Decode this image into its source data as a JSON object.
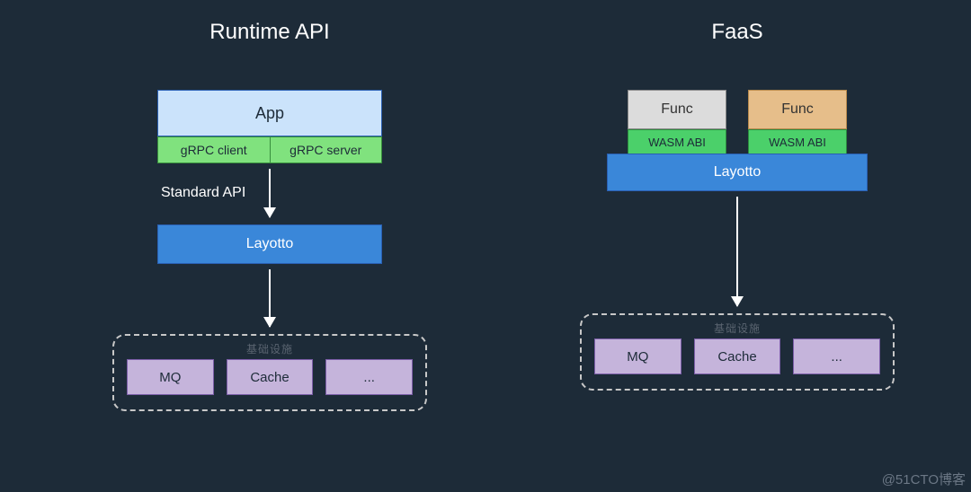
{
  "left": {
    "title": "Runtime API",
    "app_label": "App",
    "grpc_client": "gRPC client",
    "grpc_server": "gRPC server",
    "api_label": "Standard API",
    "layotto": "Layotto",
    "infra_label": "基础设施",
    "infra_items": [
      "MQ",
      "Cache",
      "..."
    ]
  },
  "right": {
    "title": "FaaS",
    "func1": "Func",
    "func2": "Func",
    "wasm1": "WASM ABI",
    "wasm2": "WASM ABI",
    "layotto": "Layotto",
    "infra_label": "基础设施",
    "infra_items": [
      "MQ",
      "Cache",
      "..."
    ]
  },
  "watermark": "@51CTO博客"
}
